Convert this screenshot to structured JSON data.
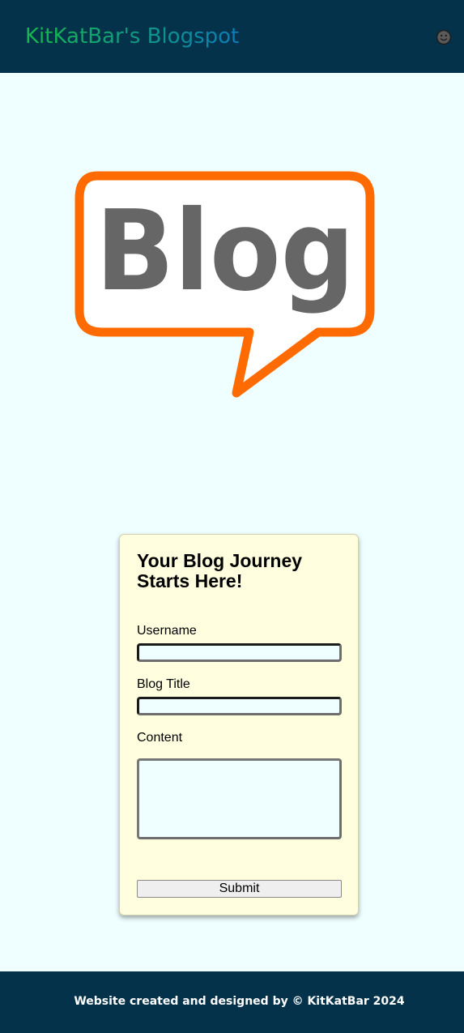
{
  "header": {
    "site_title": "KitKatBar's Blogspot",
    "theme_toggle_icon": "smiley-face-icon"
  },
  "hero": {
    "logo_text": "Blog",
    "logo_colors": {
      "outline": "#ff6b00",
      "text": "#666666",
      "fill": "#ffffff"
    }
  },
  "form": {
    "heading": "Your Blog Journey Starts Here!",
    "username_label": "Username",
    "username_value": "",
    "blog_title_label": "Blog Title",
    "blog_title_value": "",
    "content_label": "Content",
    "content_value": "",
    "submit_label": "Submit"
  },
  "footer": {
    "text": "Website created and designed by © KitKatBar 2024"
  },
  "colors": {
    "header_bg": "#04324a",
    "page_bg": "#efffff",
    "card_bg": "#ffffe0",
    "title_gradient_start": "#16b84a",
    "title_gradient_end": "#0a7cb8"
  }
}
